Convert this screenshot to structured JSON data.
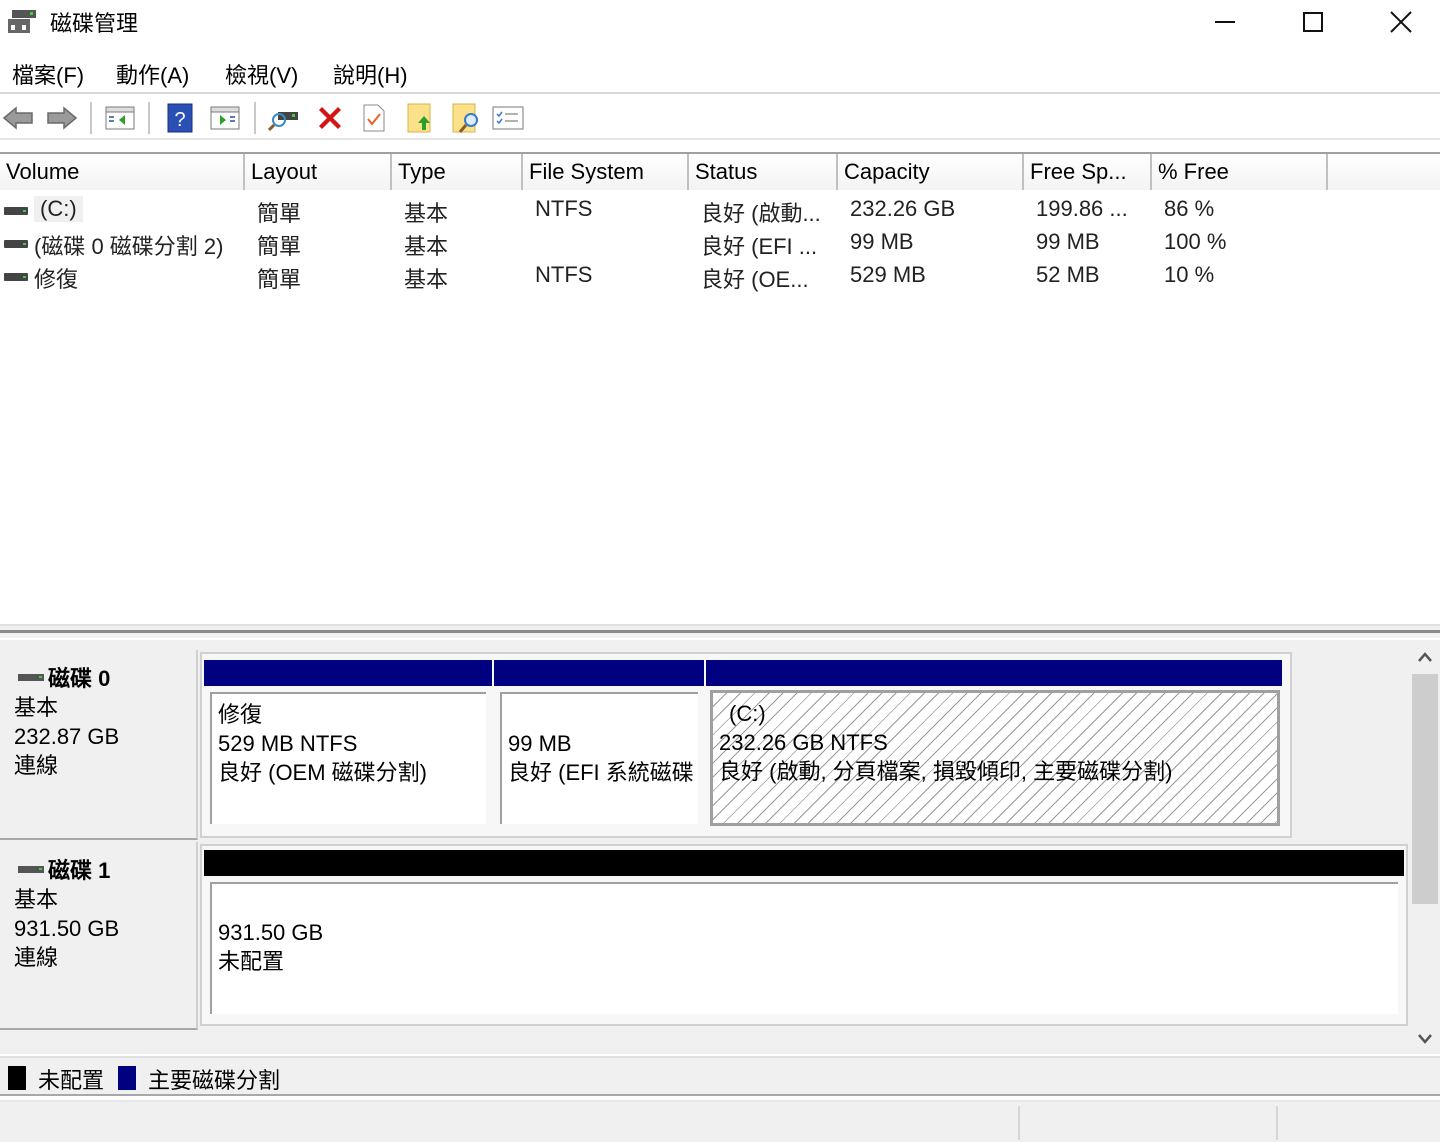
{
  "window": {
    "title": "磁碟管理",
    "icon": "disk-management-icon",
    "controls": {
      "minimize": "minimize-icon",
      "maximize": "maximize-icon",
      "close": "close-icon"
    }
  },
  "menu": {
    "items": [
      {
        "label": "檔案(F)"
      },
      {
        "label": "動作(A)"
      },
      {
        "label": "檢視(V)"
      },
      {
        "label": "說明(H)"
      }
    ]
  },
  "toolbar": {
    "buttons": [
      {
        "name": "back",
        "icon": "back-arrow-icon"
      },
      {
        "name": "forward",
        "icon": "forward-arrow-icon"
      },
      {
        "name": "show-hide-console-tree",
        "icon": "console-tree-icon"
      },
      {
        "name": "help",
        "icon": "help-icon"
      },
      {
        "name": "show-hide-action-pane",
        "icon": "action-pane-icon"
      },
      {
        "name": "connect-virtual-disk",
        "icon": "disk-search-icon"
      },
      {
        "name": "delete",
        "icon": "delete-icon"
      },
      {
        "name": "properties",
        "icon": "properties-check-icon"
      },
      {
        "name": "open-folder",
        "icon": "folder-up-icon"
      },
      {
        "name": "explore",
        "icon": "folder-search-icon"
      },
      {
        "name": "settings-list",
        "icon": "checklist-icon"
      }
    ]
  },
  "volume_list": {
    "columns": [
      "Volume",
      "Layout",
      "Type",
      "File System",
      "Status",
      "Capacity",
      "Free Sp...",
      "% Free"
    ],
    "rows": [
      {
        "volume": "(C:)",
        "layout": "簡單",
        "type": "基本",
        "file_system": "NTFS",
        "status": "良好 (啟動...",
        "capacity": "232.26 GB",
        "free_space": "199.86 ...",
        "percent_free": "86 %"
      },
      {
        "volume": "(磁碟 0 磁碟分割 2)",
        "layout": "簡單",
        "type": "基本",
        "file_system": "",
        "status": "良好 (EFI ...",
        "capacity": "99 MB",
        "free_space": "99 MB",
        "percent_free": "100 %"
      },
      {
        "volume": "修復",
        "layout": "簡單",
        "type": "基本",
        "file_system": "NTFS",
        "status": "良好 (OE...",
        "capacity": "529 MB",
        "free_space": "52 MB",
        "percent_free": "10 %"
      }
    ]
  },
  "disks": [
    {
      "name": "磁碟 0",
      "type": "基本",
      "size": "232.87 GB",
      "state": "連線",
      "partitions": [
        {
          "title": "修復",
          "size_fs": "529 MB NTFS",
          "status": "良好 (OEM 磁碟分割)",
          "kind": "primary",
          "selected": false
        },
        {
          "title": "",
          "size_fs": "99 MB",
          "status": "良好 (EFI 系統磁碟",
          "kind": "primary",
          "selected": false
        },
        {
          "title": "(C:)",
          "size_fs": "232.26 GB NTFS",
          "status": "良好 (啟動, 分頁檔案, 損毀傾印, 主要磁碟分割)",
          "kind": "primary",
          "selected": true
        }
      ]
    },
    {
      "name": "磁碟 1",
      "type": "基本",
      "size": "931.50 GB",
      "state": "連線",
      "partitions": [
        {
          "title": "",
          "size_fs": "931.50 GB",
          "status": "未配置",
          "kind": "unallocated",
          "selected": false
        }
      ]
    }
  ],
  "legend": [
    {
      "label": "未配置",
      "color": "#000000"
    },
    {
      "label": "主要磁碟分割",
      "color": "#000080"
    }
  ],
  "colors": {
    "primary_partition": "#000080",
    "unallocated": "#000000"
  }
}
